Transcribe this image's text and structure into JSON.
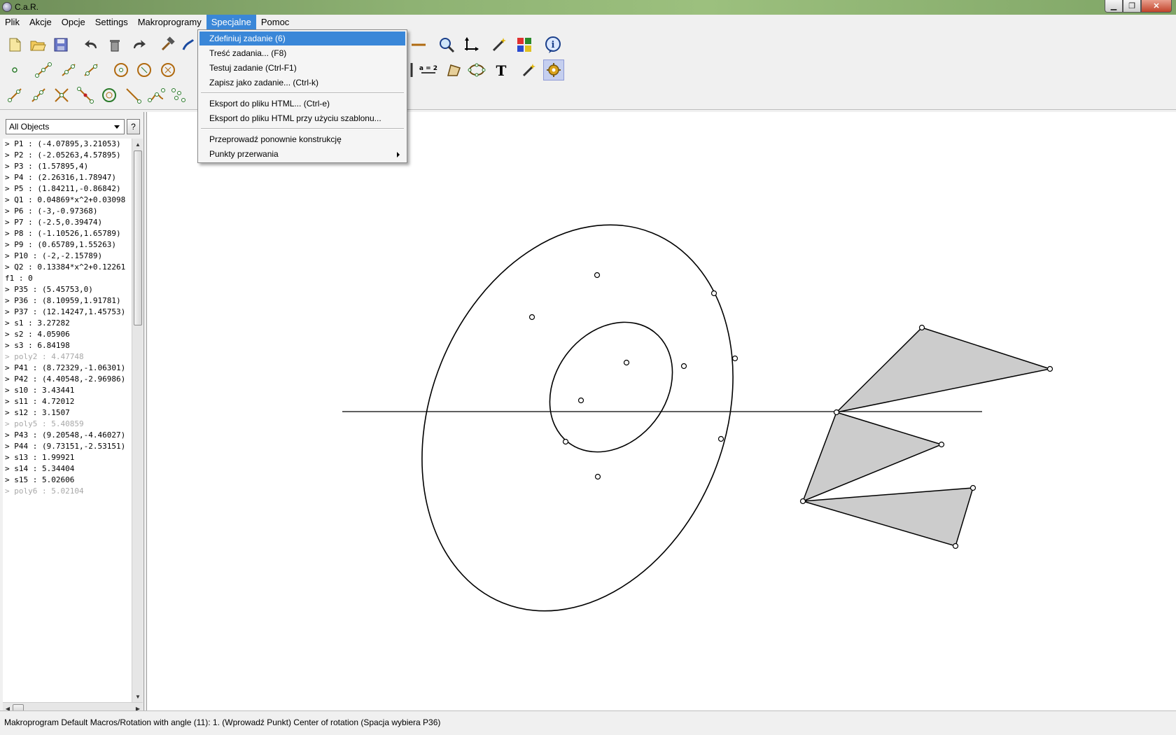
{
  "window": {
    "title": "C.a.R."
  },
  "menubar": {
    "items": [
      "Plik",
      "Akcje",
      "Opcje",
      "Settings",
      "Makroprogramy",
      "Specjalne",
      "Pomoc"
    ],
    "active_index": 5
  },
  "special_menu": {
    "items": [
      {
        "label": "Zdefiniuj zadanie (6)"
      },
      {
        "label": "Treść zadania... (F8)"
      },
      {
        "label": "Testuj zadanie (Ctrl-F1)"
      },
      {
        "label": "Zapisz jako zadanie... (Ctrl-k)"
      },
      {
        "label": "Eksport do pliku HTML... (Ctrl-e)"
      },
      {
        "label": "Eksport do pliku HTML przy użyciu szablonu..."
      },
      {
        "label": "Przeprowadź ponownie konstrukcję"
      },
      {
        "label": "Punkty przerwania"
      }
    ]
  },
  "object_panel": {
    "filter": "All Objects",
    "help_label": "?",
    "objects": [
      {
        "text": "> P1 : (-4.07895,3.21053)",
        "hidden": false
      },
      {
        "text": "> P2 : (-2.05263,4.57895)",
        "hidden": false
      },
      {
        "text": "> P3 : (1.57895,4)",
        "hidden": false
      },
      {
        "text": "> P4 : (2.26316,1.78947)",
        "hidden": false
      },
      {
        "text": "> P5 : (1.84211,-0.86842)",
        "hidden": false
      },
      {
        "text": "> Q1 : 0.04869*x^2+0.03098",
        "hidden": false
      },
      {
        "text": "> P6 : (-3,-0.97368)",
        "hidden": false
      },
      {
        "text": "> P7 : (-2.5,0.39474)",
        "hidden": false
      },
      {
        "text": "> P8 : (-1.10526,1.65789)",
        "hidden": false
      },
      {
        "text": "> P9 : (0.65789,1.55263)",
        "hidden": false
      },
      {
        "text": "> P10 : (-2,-2.15789)",
        "hidden": false
      },
      {
        "text": "> Q2 : 0.13384*x^2+0.12261",
        "hidden": false
      },
      {
        "text": "f1 : 0",
        "hidden": false
      },
      {
        "text": "> P35 : (5.45753,0)",
        "hidden": false
      },
      {
        "text": "> P36 : (8.10959,1.91781)",
        "hidden": false
      },
      {
        "text": "> P37 : (12.14247,1.45753)",
        "hidden": false
      },
      {
        "text": "> s1 : 3.27282",
        "hidden": false
      },
      {
        "text": "> s2 : 4.05906",
        "hidden": false
      },
      {
        "text": "> s3 : 6.84198",
        "hidden": false
      },
      {
        "text": "> poly2 : 4.47748",
        "hidden": true
      },
      {
        "text": "> P41 : (8.72329,-1.06301)",
        "hidden": false
      },
      {
        "text": "> P42 : (4.40548,-2.96986)",
        "hidden": false
      },
      {
        "text": "> s10 : 3.43441",
        "hidden": false
      },
      {
        "text": "> s11 : 4.72012",
        "hidden": false
      },
      {
        "text": "> s12 : 3.1507",
        "hidden": false
      },
      {
        "text": "> poly5 : 5.40859",
        "hidden": true
      },
      {
        "text": "> P43 : (9.20548,-4.46027)",
        "hidden": false
      },
      {
        "text": "> P44 : (9.73151,-2.53151)",
        "hidden": false
      },
      {
        "text": "> s13 : 1.99921",
        "hidden": false
      },
      {
        "text": "> s14 : 5.34404",
        "hidden": false
      },
      {
        "text": "> s15 : 5.02606",
        "hidden": false
      },
      {
        "text": "> poly6 : 5.02104",
        "hidden": true
      }
    ]
  },
  "toolbar": {
    "equation_label": "a = 2",
    "text_tool_label": "T",
    "info_label": "i"
  },
  "status": {
    "text": "Makroprogram Default Macros/Rotation with angle (11): 1. (Wprowadź Punkt) Center of rotation  (Spacja wybiera P36)"
  },
  "colors": {
    "menu_highlight": "#3a87d8",
    "polygon_fill": "#cccccc",
    "tool_selected": "#c5cfef"
  }
}
